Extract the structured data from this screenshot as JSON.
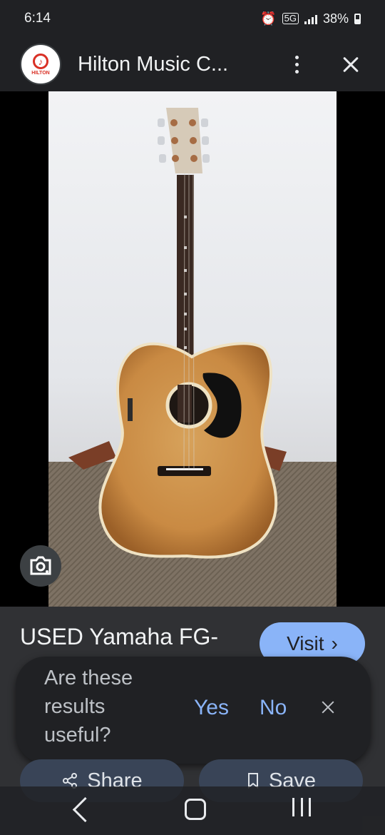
{
  "status": {
    "time": "6:14",
    "network": "5G",
    "battery": "38%"
  },
  "header": {
    "logo_text": "HILTON",
    "title": "Hilton Music C..."
  },
  "result": {
    "title": "USED Yamaha FG-",
    "visit_label": "Visit"
  },
  "feedback": {
    "question": "Are these results useful?",
    "yes_label": "Yes",
    "no_label": "No"
  },
  "actions": {
    "share_label": "Share",
    "save_label": "Save"
  },
  "icons": {
    "lens": "camera-search-icon",
    "share": "share-icon",
    "save": "bookmark-icon",
    "close": "close-icon",
    "more": "more-vertical-icon"
  }
}
